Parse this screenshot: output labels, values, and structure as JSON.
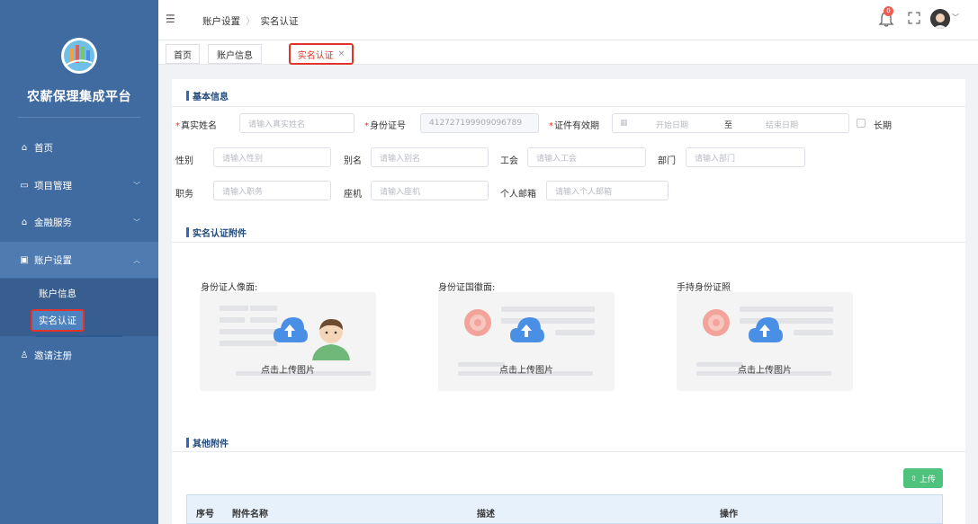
{
  "sidebar": {
    "brand": "农薪保理集成平台",
    "menu": [
      {
        "label": "首页",
        "icon": "home-icon"
      },
      {
        "label": "项目管理",
        "icon": "folder-icon"
      },
      {
        "label": "金融服务",
        "icon": "bank-icon"
      },
      {
        "label": "账户设置",
        "icon": "id-card-icon"
      },
      {
        "label": "邀请注册",
        "icon": "user-icon"
      }
    ],
    "submenu": [
      "账户信息",
      "实名认证"
    ]
  },
  "header": {
    "breadcrumb": [
      "账户设置",
      "实名认证"
    ],
    "notification_count": "0"
  },
  "tabs": [
    {
      "label": "首页"
    },
    {
      "label": "账户信息"
    },
    {
      "label": "实名认证",
      "close": "×"
    }
  ],
  "basic_info": {
    "title": "基本信息",
    "real_name": {
      "label": "真实姓名",
      "placeholder": "请输入真实姓名"
    },
    "id_number": {
      "label": "身份证号",
      "value": "412727199909096789"
    },
    "validity": {
      "label": "证件有效期",
      "start": "开始日期",
      "sep": "至",
      "end": "结束日期",
      "long_term": "长期"
    },
    "gender": {
      "label": "性别",
      "placeholder": "请输入性别"
    },
    "alias": {
      "label": "别名",
      "placeholder": "请输入别名"
    },
    "union": {
      "label": "工会",
      "placeholder": "请输入工会"
    },
    "department": {
      "label": "部门",
      "placeholder": "请输入部门"
    },
    "position": {
      "label": "职务",
      "placeholder": "请输入职务"
    },
    "landline": {
      "label": "座机",
      "placeholder": "请输入座机"
    },
    "email": {
      "label": "个人邮箱",
      "placeholder": "请输入个人邮箱"
    }
  },
  "attachments": {
    "title": "实名认证附件",
    "items": [
      {
        "label": "身份证人像面:",
        "action": "点击上传图片"
      },
      {
        "label": "身份证国徽面:",
        "action": "点击上传图片"
      },
      {
        "label": "手持身份证照",
        "action": "点击上传图片"
      }
    ]
  },
  "other": {
    "title": "其他附件",
    "upload_button": "上传",
    "columns": [
      "序号",
      "附件名称",
      "描述",
      "操作"
    ]
  },
  "colors": {
    "sidebar": "#3f6ba0",
    "accent": "#2f67c1",
    "highlight": "#e2342a",
    "upload": "#4fc27e",
    "cloud": "#4a8fe6"
  }
}
